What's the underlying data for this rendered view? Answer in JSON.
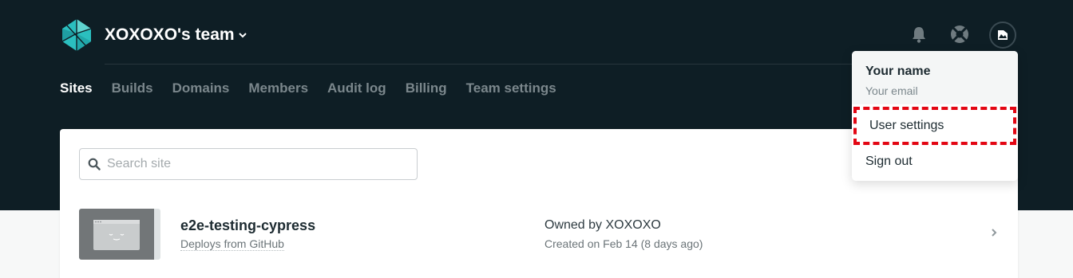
{
  "header": {
    "team_name": "XOXOXO's team"
  },
  "tabs": [
    {
      "label": "Sites",
      "active": true
    },
    {
      "label": "Builds",
      "active": false
    },
    {
      "label": "Domains",
      "active": false
    },
    {
      "label": "Members",
      "active": false
    },
    {
      "label": "Audit log",
      "active": false
    },
    {
      "label": "Billing",
      "active": false
    },
    {
      "label": "Team settings",
      "active": false
    }
  ],
  "search": {
    "placeholder": "Search site",
    "value": ""
  },
  "sites": [
    {
      "name": "e2e-testing-cypress",
      "source": "Deploys from GitHub",
      "owner": "Owned by XOXOXO",
      "created": "Created on Feb 14 (8 days ago)"
    }
  ],
  "user_menu": {
    "name": "Your name",
    "email": "Your email",
    "items": [
      "User settings",
      "Sign out"
    ],
    "highlight_color": "#e30613"
  },
  "colors": {
    "header_bg": "#0e1e25",
    "logo_teal": "#2bbfbf"
  },
  "icons": [
    "netlify-logo-icon",
    "chevron-down-icon",
    "bell-icon",
    "support-icon",
    "avatar-broken-image-icon",
    "search-icon",
    "chevron-right-icon"
  ]
}
